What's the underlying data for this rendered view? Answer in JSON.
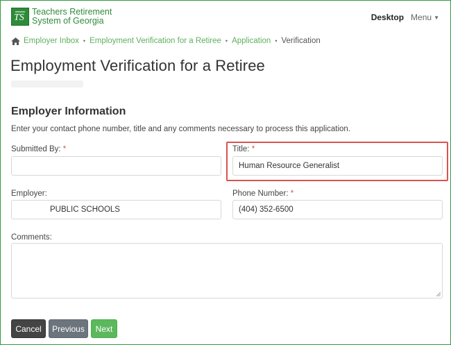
{
  "header": {
    "logo_line1": "Teachers Retirement",
    "logo_line2": "System of Georgia",
    "desktop_label": "Desktop",
    "menu_label": "Menu"
  },
  "breadcrumb": {
    "items": [
      "Employer Inbox",
      "Employment Verification for a Retiree",
      "Application"
    ],
    "current": "Verification"
  },
  "page": {
    "title": "Employment Verification for a Retiree"
  },
  "employer_info": {
    "heading": "Employer Information",
    "description": "Enter your contact phone number, title and any comments necessary to process this application.",
    "submitted_by": {
      "label": "Submitted By:",
      "value": ""
    },
    "title_field": {
      "label": "Title:",
      "value": "Human Resource Generalist"
    },
    "employer": {
      "label": "Employer:",
      "value": "PUBLIC SCHOOLS"
    },
    "phone": {
      "label": "Phone Number:",
      "value": "(404) 352-6500"
    },
    "comments": {
      "label": "Comments:",
      "value": ""
    },
    "required_marker": "*"
  },
  "actions": {
    "cancel_label": "Cancel",
    "previous_label": "Previous",
    "next_label": "Next"
  },
  "colors": {
    "brand_green": "#2e8b3a",
    "link_green": "#5fae5f",
    "required_red": "#d9534f",
    "next_green": "#5cb85c"
  }
}
